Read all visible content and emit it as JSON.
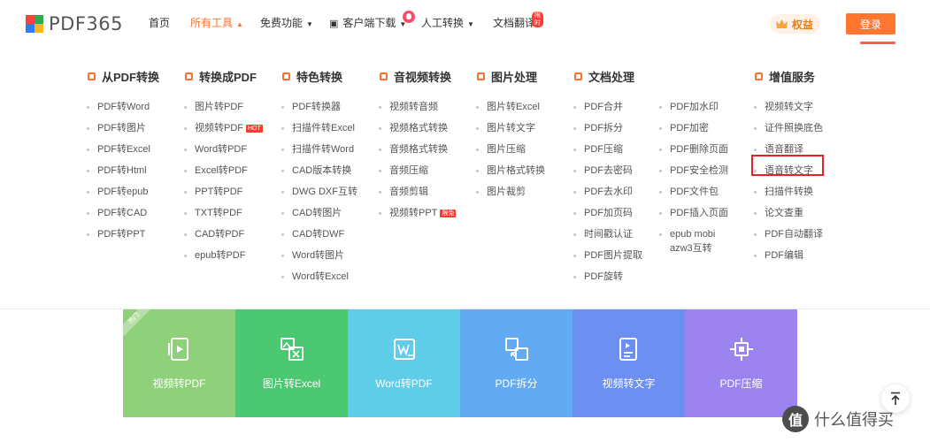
{
  "header": {
    "logo_text": "PDF365",
    "logo_colors": [
      "#f5443b",
      "#2fa84f",
      "#2e7cf6",
      "#f8b51d"
    ],
    "nav": [
      {
        "label": "首页"
      },
      {
        "label": "所有工具",
        "active": true
      },
      {
        "label": "免费功能"
      },
      {
        "label": "客户端下载"
      },
      {
        "label": "人工转换"
      },
      {
        "label": "文档翻译",
        "badge": "限时"
      }
    ],
    "quanyi_label": "权益",
    "login_label": "登录"
  },
  "menu": {
    "columns": [
      {
        "heading": "从PDF转换",
        "items": [
          "PDF转Word",
          "PDF转图片",
          "PDF转Excel",
          "PDF转Html",
          "PDF转epub",
          "PDF转CAD",
          "PDF转PPT"
        ]
      },
      {
        "heading": "转换成PDF",
        "items": [
          "图片转PDF",
          "视频转PDF",
          "Word转PDF",
          "Excel转PDF",
          "PPT转PDF",
          "TXT转PDF",
          "CAD转PDF",
          "epub转PDF"
        ],
        "hot_tag": "HOT"
      },
      {
        "heading": "特色转换",
        "items": [
          "PDF转换器",
          "扫描件转Excel",
          "扫描件转Word",
          "CAD版本转换",
          "DWG DXF互转",
          "CAD转图片",
          "CAD转DWF",
          "Word转图片",
          "Word转Excel"
        ]
      },
      {
        "heading": "音视频转换",
        "items": [
          "视频转音频",
          "视频格式转换",
          "音频格式转换",
          "音频压缩",
          "音频剪辑",
          "视频转PPT"
        ],
        "free_tag": "限免"
      },
      {
        "heading": "图片处理",
        "items": [
          "图片转Excel",
          "图片转文字",
          "图片压缩",
          "图片格式转换",
          "图片裁剪"
        ]
      },
      {
        "heading": "文档处理",
        "items": [
          "PDF合并",
          "PDF拆分",
          "PDF压缩",
          "PDF去密码",
          "PDF去水印",
          "PDF加页码",
          "时间戳认证",
          "PDF图片提取",
          "PDF旋转"
        ]
      },
      {
        "heading": "",
        "items": [
          "PDF加水印",
          "PDF加密",
          "PDF删除页面",
          "PDF安全检测",
          "PDF文件包",
          "PDF插入页面",
          "epub mobi azw3互转"
        ]
      },
      {
        "heading": "增值服务",
        "items": [
          "视频转文字",
          "证件照换底色",
          "语音翻译",
          "语音转文字",
          "扫描件转换",
          "论文查重",
          "PDF自动翻译",
          "PDF编辑"
        ]
      }
    ]
  },
  "features": {
    "ribbon": "热门",
    "tiles": [
      {
        "label": "视频转PDF",
        "color": "#8fd07a",
        "icon": "video-doc-icon"
      },
      {
        "label": "图片转Excel",
        "color": "#4cc872",
        "icon": "image-excel-icon"
      },
      {
        "label": "Word转PDF",
        "color": "#5fcde8",
        "icon": "word-icon"
      },
      {
        "label": "PDF拆分",
        "color": "#62aaf2",
        "icon": "split-icon"
      },
      {
        "label": "视频转文字",
        "color": "#6d8ff2",
        "icon": "video-text-icon"
      },
      {
        "label": "PDF压缩",
        "color": "#9b83f0",
        "icon": "compress-icon"
      }
    ]
  },
  "watermark": {
    "logo": "值",
    "text": "什么值得买"
  },
  "accent": "#ff6f2c",
  "highlight_color": "#e52420"
}
